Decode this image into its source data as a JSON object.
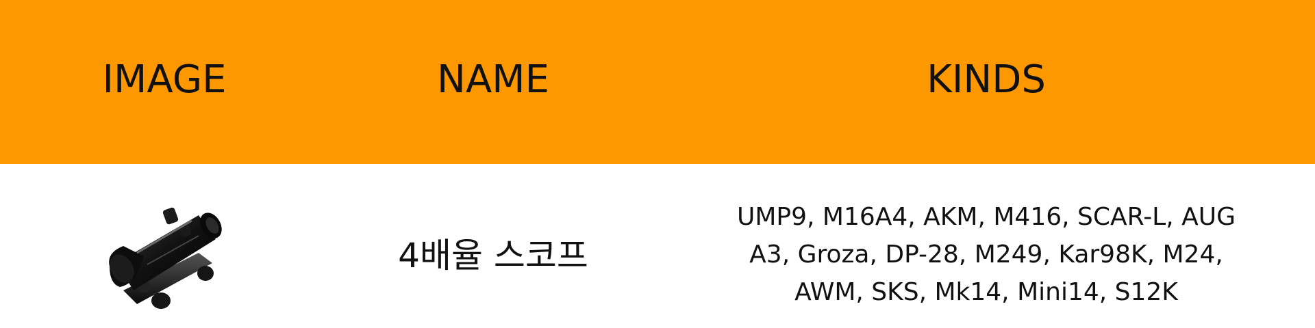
{
  "header": {
    "image_label": "IMAGE",
    "name_label": "NAME",
    "kinds_label": "KINDS"
  },
  "row": {
    "name": "4배율 스코프",
    "kinds": "UMP9, M16A4, AKM, M416, SCAR-L, AUG A3, Groza, DP-28, M249, Kar98K, M24, AWM, SKS, Mk14, Mini14, S12K",
    "image_icon": "scope-icon"
  },
  "colors": {
    "header_bg": "#fd9800",
    "row_bg": "#ffffff",
    "text": "#111111"
  }
}
